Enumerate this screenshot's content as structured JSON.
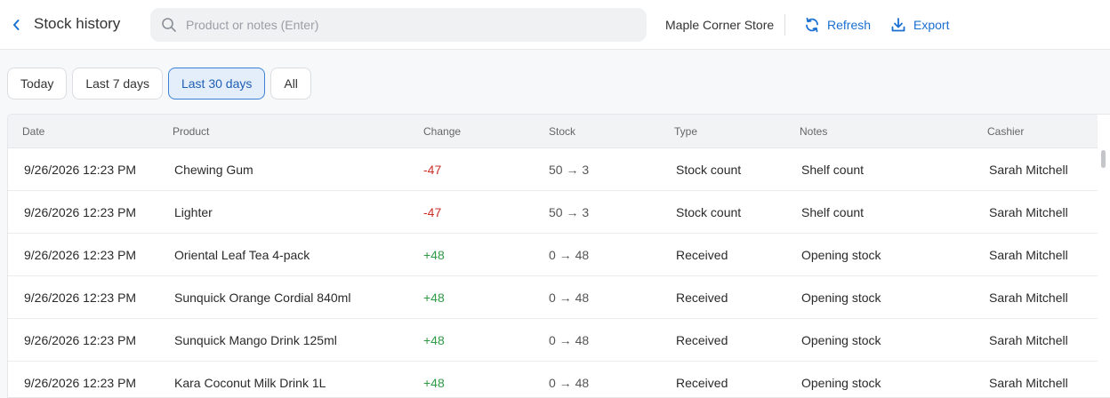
{
  "header": {
    "title": "Stock history",
    "search_placeholder": "Product or notes (Enter)",
    "store_name": "Maple Corner Store",
    "refresh_label": "Refresh",
    "export_label": "Export"
  },
  "filters": [
    {
      "label": "Today",
      "active": false
    },
    {
      "label": "Last 7 days",
      "active": false
    },
    {
      "label": "Last 30 days",
      "active": true
    },
    {
      "label": "All",
      "active": false
    }
  ],
  "table": {
    "columns": [
      "Date",
      "Product",
      "Change",
      "Stock",
      "Type",
      "Notes",
      "Cashier"
    ],
    "rows": [
      {
        "date": "9/26/2026 12:23 PM",
        "product": "Chewing Gum",
        "change": "-47",
        "stock": "50 → 3",
        "type": "Stock count",
        "notes": "Shelf count",
        "cashier": "Sarah Mitchell"
      },
      {
        "date": "9/26/2026 12:23 PM",
        "product": "Lighter",
        "change": "-47",
        "stock": "50 → 3",
        "type": "Stock count",
        "notes": "Shelf count",
        "cashier": "Sarah Mitchell"
      },
      {
        "date": "9/26/2026 12:23 PM",
        "product": "Oriental Leaf Tea 4-pack",
        "change": "+48",
        "stock": "0 → 48",
        "type": "Received",
        "notes": "Opening stock",
        "cashier": "Sarah Mitchell"
      },
      {
        "date": "9/26/2026 12:23 PM",
        "product": "Sunquick Orange Cordial 840ml",
        "change": "+48",
        "stock": "0 → 48",
        "type": "Received",
        "notes": "Opening stock",
        "cashier": "Sarah Mitchell"
      },
      {
        "date": "9/26/2026 12:23 PM",
        "product": "Sunquick Mango Drink 125ml",
        "change": "+48",
        "stock": "0 → 48",
        "type": "Received",
        "notes": "Opening stock",
        "cashier": "Sarah Mitchell"
      },
      {
        "date": "9/26/2026 12:23 PM",
        "product": "Kara Coconut Milk Drink 1L",
        "change": "+48",
        "stock": "0 → 48",
        "type": "Received",
        "notes": "Opening stock",
        "cashier": "Sarah Mitchell"
      }
    ]
  },
  "colors": {
    "accent": "#1a6fd1",
    "negative": "#c9302c",
    "positive": "#2e9a46"
  },
  "icons": {
    "back": "chevron-left-icon",
    "search": "search-icon",
    "refresh": "refresh-icon",
    "export": "download-icon"
  }
}
